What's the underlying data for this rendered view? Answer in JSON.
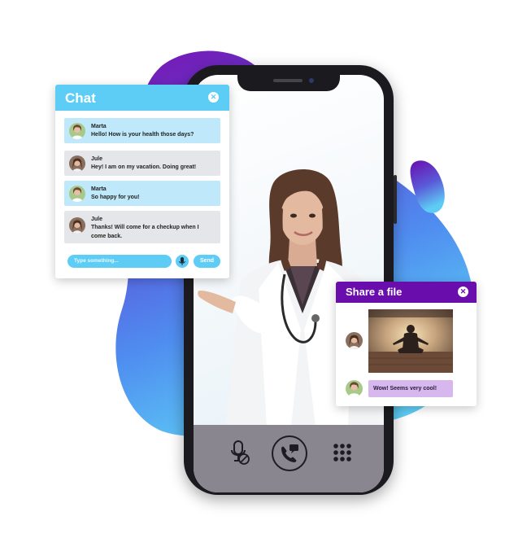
{
  "colors": {
    "chat_accent": "#5ecdf5",
    "share_accent": "#6a0dad",
    "blob_purple": "#6a0dad",
    "blob_blue": "#5ecdf5"
  },
  "chat": {
    "title": "Chat",
    "close_icon": "close-icon",
    "messages": [
      {
        "sender": "Marta",
        "text": "Hello! How is your health those days?",
        "style": "blue"
      },
      {
        "sender": "Jule",
        "text": "Hey! I am on my vacation. Doing great!",
        "style": "gray"
      },
      {
        "sender": "Marta",
        "text": "So happy for you!",
        "style": "blue"
      },
      {
        "sender": "Jule",
        "text": "Thanks! Will come for a checkup when I come back.",
        "style": "gray"
      }
    ],
    "input_placeholder": "Type something...",
    "mic_icon": "microphone-icon",
    "send_label": "Send"
  },
  "share": {
    "title": "Share a file",
    "close_icon": "close-icon",
    "photo": "meditation-photo",
    "reply_text": "Wow! Seems very cool!"
  },
  "call_controls": [
    "mute-microphone-icon",
    "call-chat-icon",
    "keypad-icon"
  ]
}
